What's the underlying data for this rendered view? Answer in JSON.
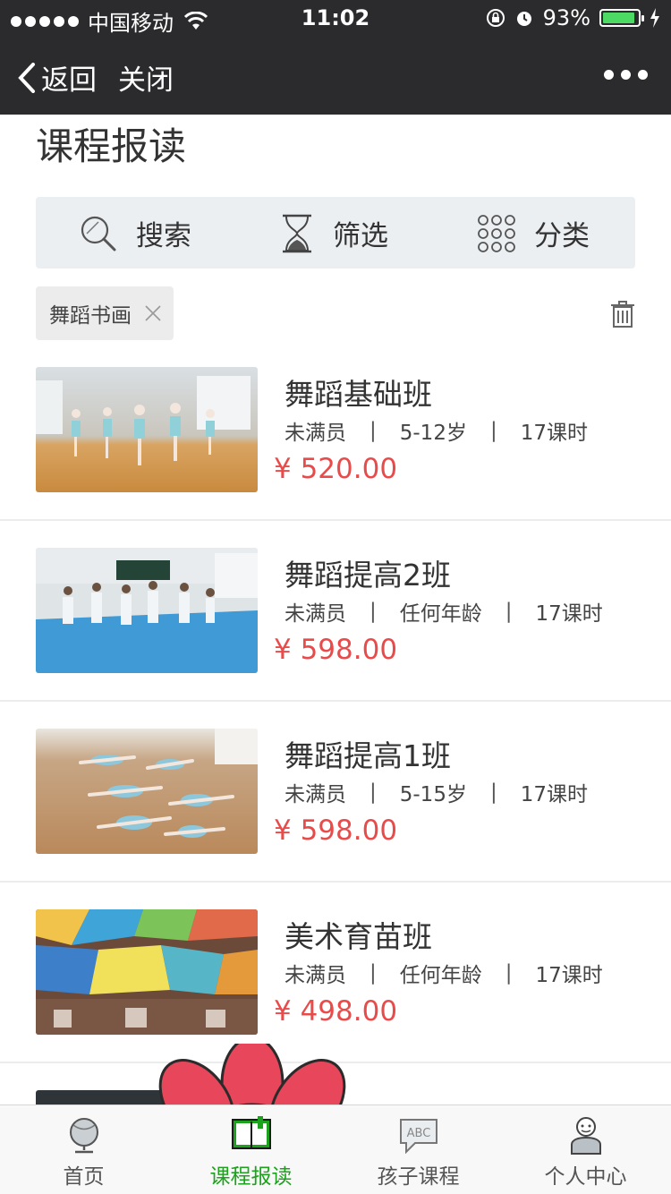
{
  "status_bar": {
    "carrier": "中国移动",
    "time": "11:02",
    "battery": "93%",
    "battery_level": 0.93
  },
  "nav": {
    "back_label": "返回",
    "close_label": "关闭"
  },
  "page": {
    "title": "课程报读"
  },
  "toolbar": {
    "search_label": "搜索",
    "filter_label": "筛选",
    "category_label": "分类"
  },
  "active_filter": {
    "label": "舞蹈书画"
  },
  "courses": [
    {
      "name": "舞蹈基础班",
      "status": "未满员",
      "age": "5-12岁",
      "hours": "17课时",
      "price": "¥ 520.00"
    },
    {
      "name": "舞蹈提高2班",
      "status": "未满员",
      "age": "任何年龄",
      "hours": "17课时",
      "price": "¥ 598.00"
    },
    {
      "name": "舞蹈提高1班",
      "status": "未满员",
      "age": "5-15岁",
      "hours": "17课时",
      "price": "¥ 598.00"
    },
    {
      "name": "美术育苗班",
      "status": "未满员",
      "age": "任何年龄",
      "hours": "17课时",
      "price": "¥ 498.00"
    },
    {
      "name": "",
      "status": "",
      "age": "",
      "hours": "",
      "price": ""
    }
  ],
  "tabs": [
    {
      "label": "首页",
      "icon": "globe-icon"
    },
    {
      "label": "课程报读",
      "icon": "book-icon"
    },
    {
      "label": "孩子课程",
      "icon": "abc-bubble-icon"
    },
    {
      "label": "个人中心",
      "icon": "person-icon"
    }
  ],
  "colors": {
    "accent": "#1ca21c",
    "price": "#e94b4b",
    "bar": "#2b2b2d",
    "flower": "#e8465a"
  }
}
